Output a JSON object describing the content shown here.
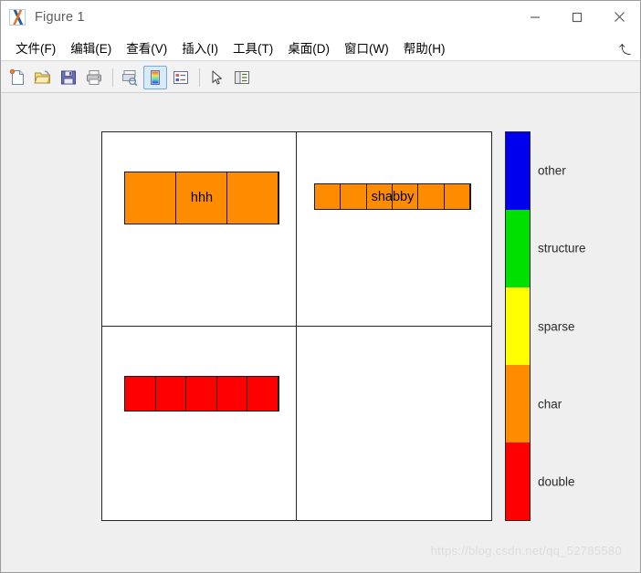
{
  "window": {
    "title": "Figure 1",
    "app_icon": "matlab-icon",
    "minimize": "─",
    "maximize": "□",
    "close": "✕"
  },
  "menubar": {
    "items": [
      {
        "label": "文件(F)",
        "name": "menu-file"
      },
      {
        "label": "编辑(E)",
        "name": "menu-edit"
      },
      {
        "label": "查看(V)",
        "name": "menu-view"
      },
      {
        "label": "插入(I)",
        "name": "menu-insert"
      },
      {
        "label": "工具(T)",
        "name": "menu-tools"
      },
      {
        "label": "桌面(D)",
        "name": "menu-desktop"
      },
      {
        "label": "窗口(W)",
        "name": "menu-window"
      },
      {
        "label": "帮助(H)",
        "name": "menu-help"
      }
    ],
    "expand_glyph": "⤴"
  },
  "toolbar": {
    "buttons": [
      {
        "name": "new-figure-icon",
        "tip": "New Figure"
      },
      {
        "name": "open-file-icon",
        "tip": "Open File"
      },
      {
        "name": "save-figure-icon",
        "tip": "Save Figure"
      },
      {
        "name": "print-figure-icon",
        "tip": "Print Figure"
      },
      {
        "name": "print-preview-icon",
        "tip": "Print Preview"
      },
      {
        "name": "insert-colorbar-icon",
        "tip": "Insert Colorbar",
        "active": true
      },
      {
        "name": "insert-legend-icon",
        "tip": "Insert Legend"
      },
      {
        "name": "pointer-arrow-icon",
        "tip": "Edit Plot"
      },
      {
        "name": "show-plot-tools-icon",
        "tip": "Show Plot Tools and Dock Figure"
      }
    ]
  },
  "chart_data": {
    "type": "heatmap",
    "title": "",
    "subtitle": "",
    "xlabel": "",
    "ylabel": "",
    "grid": false,
    "layout": "2x2 subplot grid of memory-map axes",
    "legend_position": "right (vertical colorbar)",
    "colormap": [
      {
        "label": "double",
        "color": "#ff0000",
        "index": 1
      },
      {
        "label": "char",
        "color": "#ff8c00",
        "index": 2
      },
      {
        "label": "sparse",
        "color": "#ffff00",
        "index": 3
      },
      {
        "label": "structure",
        "color": "#00e000",
        "index": 4
      },
      {
        "label": "other",
        "color": "#0000ee",
        "index": 5
      }
    ],
    "colorbar_ticks_top_to_bottom": [
      "other",
      "structure",
      "sparse",
      "char",
      "double"
    ],
    "panels": [
      {
        "name": "panel-top-left",
        "row": 1,
        "col": 1,
        "blocks": [
          {
            "cells": 3,
            "color": "#ff8c00",
            "category": "char",
            "label": "hhh"
          }
        ]
      },
      {
        "name": "panel-top-right",
        "row": 1,
        "col": 2,
        "blocks": [
          {
            "cells": 6,
            "color": "#ff8c00",
            "category": "char",
            "label": "shabby"
          }
        ]
      },
      {
        "name": "panel-bottom-left",
        "row": 2,
        "col": 1,
        "blocks": [
          {
            "cells": 5,
            "color": "#ff0000",
            "category": "double",
            "label": ""
          }
        ]
      },
      {
        "name": "panel-bottom-right",
        "row": 2,
        "col": 2,
        "blocks": []
      }
    ]
  },
  "watermark": {
    "text": "https://blog.csdn.net/qq_52785580"
  }
}
